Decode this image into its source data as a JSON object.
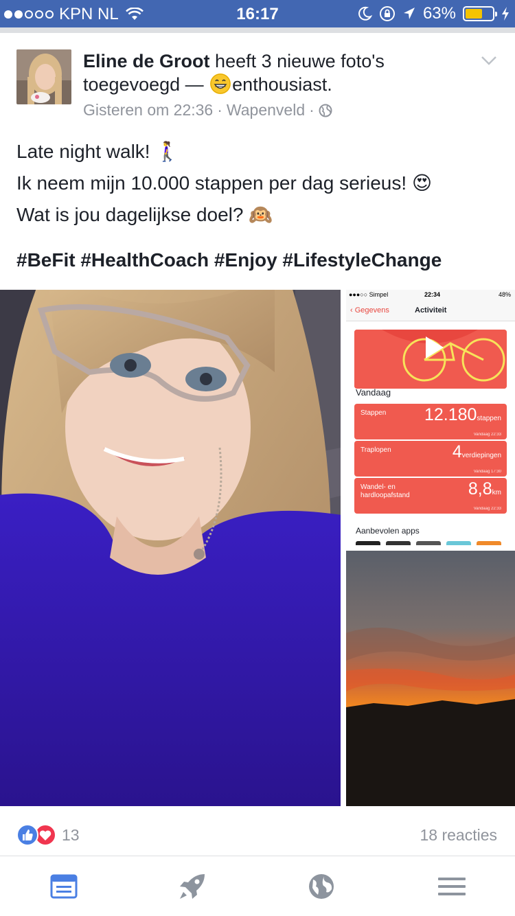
{
  "status_bar": {
    "carrier": "KPN NL",
    "time": "16:17",
    "battery_percent": "63%",
    "battery_level": 0.63,
    "signal_bars_filled": 2,
    "signal_bars_total": 5
  },
  "post": {
    "author": "Eline de Groot",
    "action": "heeft 3 nieuwe foto's",
    "action_line2": "toegevoegd —",
    "feeling": "enthousiast.",
    "timestamp": "Gisteren om 22:36",
    "location": "Wapenveld",
    "separator": "·",
    "text_lines": [
      "Late night walk! 🚶‍♀️",
      "Ik neem mijn 10.000 stappen per dag serieus! 😍",
      "Wat is jou dagelijkse doel? 🙉"
    ],
    "hashtags": "#BeFit #HealthCoach #Enjoy #LifestyleChange"
  },
  "health_screenshot": {
    "carrier": "●●●○○ Simpel",
    "time": "22:34",
    "battery": "48%",
    "back_label": "‹ Gegevens",
    "title": "Activiteit",
    "section": "Vandaag",
    "cards": [
      {
        "label": "Stappen",
        "value": "12.180",
        "unit": "stappen",
        "timestamp": "Vandaag 22:33"
      },
      {
        "label": "Traplopen",
        "value": "4",
        "unit": "verdiepingen",
        "timestamp": "Vandaag 17:30"
      },
      {
        "label": "Wandel- en hardloopafstand",
        "value": "8,8",
        "unit": "km",
        "timestamp": "Vandaag 22:33"
      }
    ],
    "recommended": "Aanbevolen apps"
  },
  "reactions": {
    "count": "13",
    "comments": "18 reacties"
  },
  "tabs": [
    {
      "name": "news-feed",
      "icon": "news-feed-icon",
      "active": true
    },
    {
      "name": "explore",
      "icon": "rocket-icon",
      "active": false
    },
    {
      "name": "notifications",
      "icon": "globe-icon",
      "active": false
    },
    {
      "name": "menu",
      "icon": "menu-icon",
      "active": false
    }
  ],
  "colors": {
    "brand": "#4267b2",
    "active_tab": "#4a7fe3",
    "inactive_tab": "#8d949e",
    "health_red": "#f05a4f"
  }
}
